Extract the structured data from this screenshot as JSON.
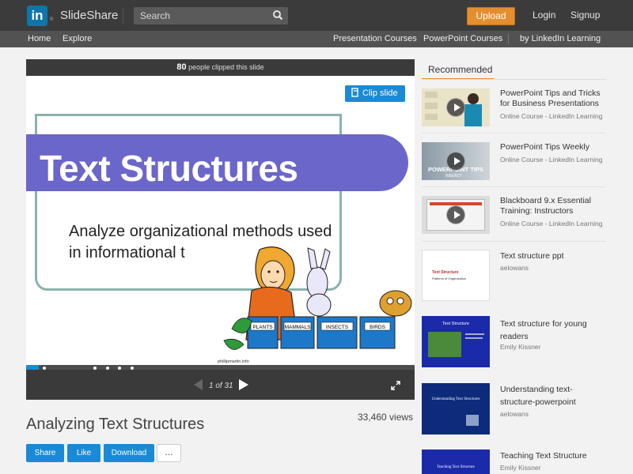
{
  "header": {
    "logo_text": "in",
    "logo_reg": "®",
    "brand": "SlideShare",
    "search_placeholder": "Search",
    "upload_label": "Upload",
    "login_label": "Login",
    "signup_label": "Signup"
  },
  "nav": {
    "home": "Home",
    "explore": "Explore",
    "presentation_courses": "Presentation Courses",
    "powerpoint_courses": "PowerPoint Courses",
    "linkedin_learning": "by LinkedIn Learning"
  },
  "player": {
    "clip_count": "80",
    "clip_text": "people clipped this slide",
    "clip_button": "Clip slide",
    "slide_title": "Text Structures",
    "slide_subtitle": "Analyze organizational methods used in informational t",
    "cartoon_labels": [
      "PLANTS",
      "MAMMALS",
      "INSECTS",
      "BIRDS"
    ],
    "cartoon_credit": "phillipmartin.info",
    "page_current": "1",
    "page_of": "of",
    "page_total": "31",
    "progress_fraction": 0.032
  },
  "presentation": {
    "title": "Analyzing Text Structures",
    "views": "33,460 views",
    "share_label": "Share",
    "like_label": "Like",
    "download_label": "Download",
    "more_label": "..."
  },
  "sidebar": {
    "tab_label": "Recommended",
    "items": [
      {
        "title": "PowerPoint Tips and Tricks for Business Presentations",
        "meta": "Online Course - LinkedIn Learning"
      },
      {
        "title": "PowerPoint Tips Weekly",
        "meta": "Online Course - LinkedIn Learning",
        "thumb_text": "POWERPOINT TIPS",
        "thumb_sub": "WEEKLY"
      },
      {
        "title": "Blackboard 9.x Essential Training: Instructors",
        "meta": "Online Course - LinkedIn Learning"
      },
      {
        "title": "Text structure ppt",
        "meta": "aelowans",
        "thumb_text": "Text Structure",
        "thumb_sub": "Patterns of Organization"
      },
      {
        "title": "Text structure for young readers",
        "meta": "Emily Kissner",
        "thumb_text": "Text Structure"
      },
      {
        "title": "Understanding text-structure-powerpoint",
        "meta": "aelowans",
        "thumb_text": "Understanding Text Structures"
      },
      {
        "title": "Teaching Text Structure",
        "meta": "Emily Kissner",
        "thumb_text": "Teaching Text Structure"
      }
    ]
  },
  "colors": {
    "accent_blue": "#1a8ad4",
    "upload_orange": "#e58e2f",
    "banner_purple": "#6b66c9"
  }
}
